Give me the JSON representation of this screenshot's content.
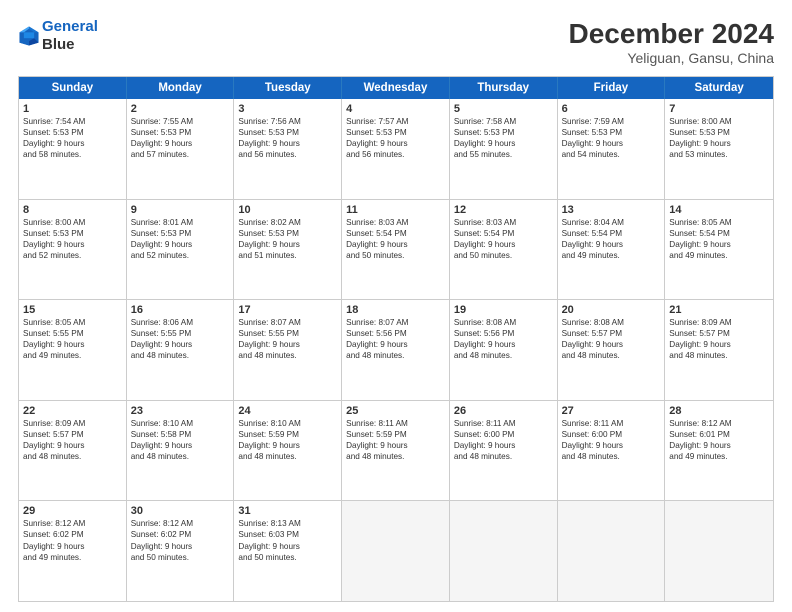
{
  "header": {
    "logo_line1": "General",
    "logo_line2": "Blue",
    "month_title": "December 2024",
    "location": "Yeliguan, Gansu, China"
  },
  "days_of_week": [
    "Sunday",
    "Monday",
    "Tuesday",
    "Wednesday",
    "Thursday",
    "Friday",
    "Saturday"
  ],
  "rows": [
    [
      {
        "day": "1",
        "lines": [
          "Sunrise: 7:54 AM",
          "Sunset: 5:53 PM",
          "Daylight: 9 hours",
          "and 58 minutes."
        ]
      },
      {
        "day": "2",
        "lines": [
          "Sunrise: 7:55 AM",
          "Sunset: 5:53 PM",
          "Daylight: 9 hours",
          "and 57 minutes."
        ]
      },
      {
        "day": "3",
        "lines": [
          "Sunrise: 7:56 AM",
          "Sunset: 5:53 PM",
          "Daylight: 9 hours",
          "and 56 minutes."
        ]
      },
      {
        "day": "4",
        "lines": [
          "Sunrise: 7:57 AM",
          "Sunset: 5:53 PM",
          "Daylight: 9 hours",
          "and 56 minutes."
        ]
      },
      {
        "day": "5",
        "lines": [
          "Sunrise: 7:58 AM",
          "Sunset: 5:53 PM",
          "Daylight: 9 hours",
          "and 55 minutes."
        ]
      },
      {
        "day": "6",
        "lines": [
          "Sunrise: 7:59 AM",
          "Sunset: 5:53 PM",
          "Daylight: 9 hours",
          "and 54 minutes."
        ]
      },
      {
        "day": "7",
        "lines": [
          "Sunrise: 8:00 AM",
          "Sunset: 5:53 PM",
          "Daylight: 9 hours",
          "and 53 minutes."
        ]
      }
    ],
    [
      {
        "day": "8",
        "lines": [
          "Sunrise: 8:00 AM",
          "Sunset: 5:53 PM",
          "Daylight: 9 hours",
          "and 52 minutes."
        ]
      },
      {
        "day": "9",
        "lines": [
          "Sunrise: 8:01 AM",
          "Sunset: 5:53 PM",
          "Daylight: 9 hours",
          "and 52 minutes."
        ]
      },
      {
        "day": "10",
        "lines": [
          "Sunrise: 8:02 AM",
          "Sunset: 5:53 PM",
          "Daylight: 9 hours",
          "and 51 minutes."
        ]
      },
      {
        "day": "11",
        "lines": [
          "Sunrise: 8:03 AM",
          "Sunset: 5:54 PM",
          "Daylight: 9 hours",
          "and 50 minutes."
        ]
      },
      {
        "day": "12",
        "lines": [
          "Sunrise: 8:03 AM",
          "Sunset: 5:54 PM",
          "Daylight: 9 hours",
          "and 50 minutes."
        ]
      },
      {
        "day": "13",
        "lines": [
          "Sunrise: 8:04 AM",
          "Sunset: 5:54 PM",
          "Daylight: 9 hours",
          "and 49 minutes."
        ]
      },
      {
        "day": "14",
        "lines": [
          "Sunrise: 8:05 AM",
          "Sunset: 5:54 PM",
          "Daylight: 9 hours",
          "and 49 minutes."
        ]
      }
    ],
    [
      {
        "day": "15",
        "lines": [
          "Sunrise: 8:05 AM",
          "Sunset: 5:55 PM",
          "Daylight: 9 hours",
          "and 49 minutes."
        ]
      },
      {
        "day": "16",
        "lines": [
          "Sunrise: 8:06 AM",
          "Sunset: 5:55 PM",
          "Daylight: 9 hours",
          "and 48 minutes."
        ]
      },
      {
        "day": "17",
        "lines": [
          "Sunrise: 8:07 AM",
          "Sunset: 5:55 PM",
          "Daylight: 9 hours",
          "and 48 minutes."
        ]
      },
      {
        "day": "18",
        "lines": [
          "Sunrise: 8:07 AM",
          "Sunset: 5:56 PM",
          "Daylight: 9 hours",
          "and 48 minutes."
        ]
      },
      {
        "day": "19",
        "lines": [
          "Sunrise: 8:08 AM",
          "Sunset: 5:56 PM",
          "Daylight: 9 hours",
          "and 48 minutes."
        ]
      },
      {
        "day": "20",
        "lines": [
          "Sunrise: 8:08 AM",
          "Sunset: 5:57 PM",
          "Daylight: 9 hours",
          "and 48 minutes."
        ]
      },
      {
        "day": "21",
        "lines": [
          "Sunrise: 8:09 AM",
          "Sunset: 5:57 PM",
          "Daylight: 9 hours",
          "and 48 minutes."
        ]
      }
    ],
    [
      {
        "day": "22",
        "lines": [
          "Sunrise: 8:09 AM",
          "Sunset: 5:57 PM",
          "Daylight: 9 hours",
          "and 48 minutes."
        ]
      },
      {
        "day": "23",
        "lines": [
          "Sunrise: 8:10 AM",
          "Sunset: 5:58 PM",
          "Daylight: 9 hours",
          "and 48 minutes."
        ]
      },
      {
        "day": "24",
        "lines": [
          "Sunrise: 8:10 AM",
          "Sunset: 5:59 PM",
          "Daylight: 9 hours",
          "and 48 minutes."
        ]
      },
      {
        "day": "25",
        "lines": [
          "Sunrise: 8:11 AM",
          "Sunset: 5:59 PM",
          "Daylight: 9 hours",
          "and 48 minutes."
        ]
      },
      {
        "day": "26",
        "lines": [
          "Sunrise: 8:11 AM",
          "Sunset: 6:00 PM",
          "Daylight: 9 hours",
          "and 48 minutes."
        ]
      },
      {
        "day": "27",
        "lines": [
          "Sunrise: 8:11 AM",
          "Sunset: 6:00 PM",
          "Daylight: 9 hours",
          "and 48 minutes."
        ]
      },
      {
        "day": "28",
        "lines": [
          "Sunrise: 8:12 AM",
          "Sunset: 6:01 PM",
          "Daylight: 9 hours",
          "and 49 minutes."
        ]
      }
    ],
    [
      {
        "day": "29",
        "lines": [
          "Sunrise: 8:12 AM",
          "Sunset: 6:02 PM",
          "Daylight: 9 hours",
          "and 49 minutes."
        ]
      },
      {
        "day": "30",
        "lines": [
          "Sunrise: 8:12 AM",
          "Sunset: 6:02 PM",
          "Daylight: 9 hours",
          "and 50 minutes."
        ]
      },
      {
        "day": "31",
        "lines": [
          "Sunrise: 8:13 AM",
          "Sunset: 6:03 PM",
          "Daylight: 9 hours",
          "and 50 minutes."
        ]
      },
      {
        "day": "",
        "lines": []
      },
      {
        "day": "",
        "lines": []
      },
      {
        "day": "",
        "lines": []
      },
      {
        "day": "",
        "lines": []
      }
    ]
  ]
}
